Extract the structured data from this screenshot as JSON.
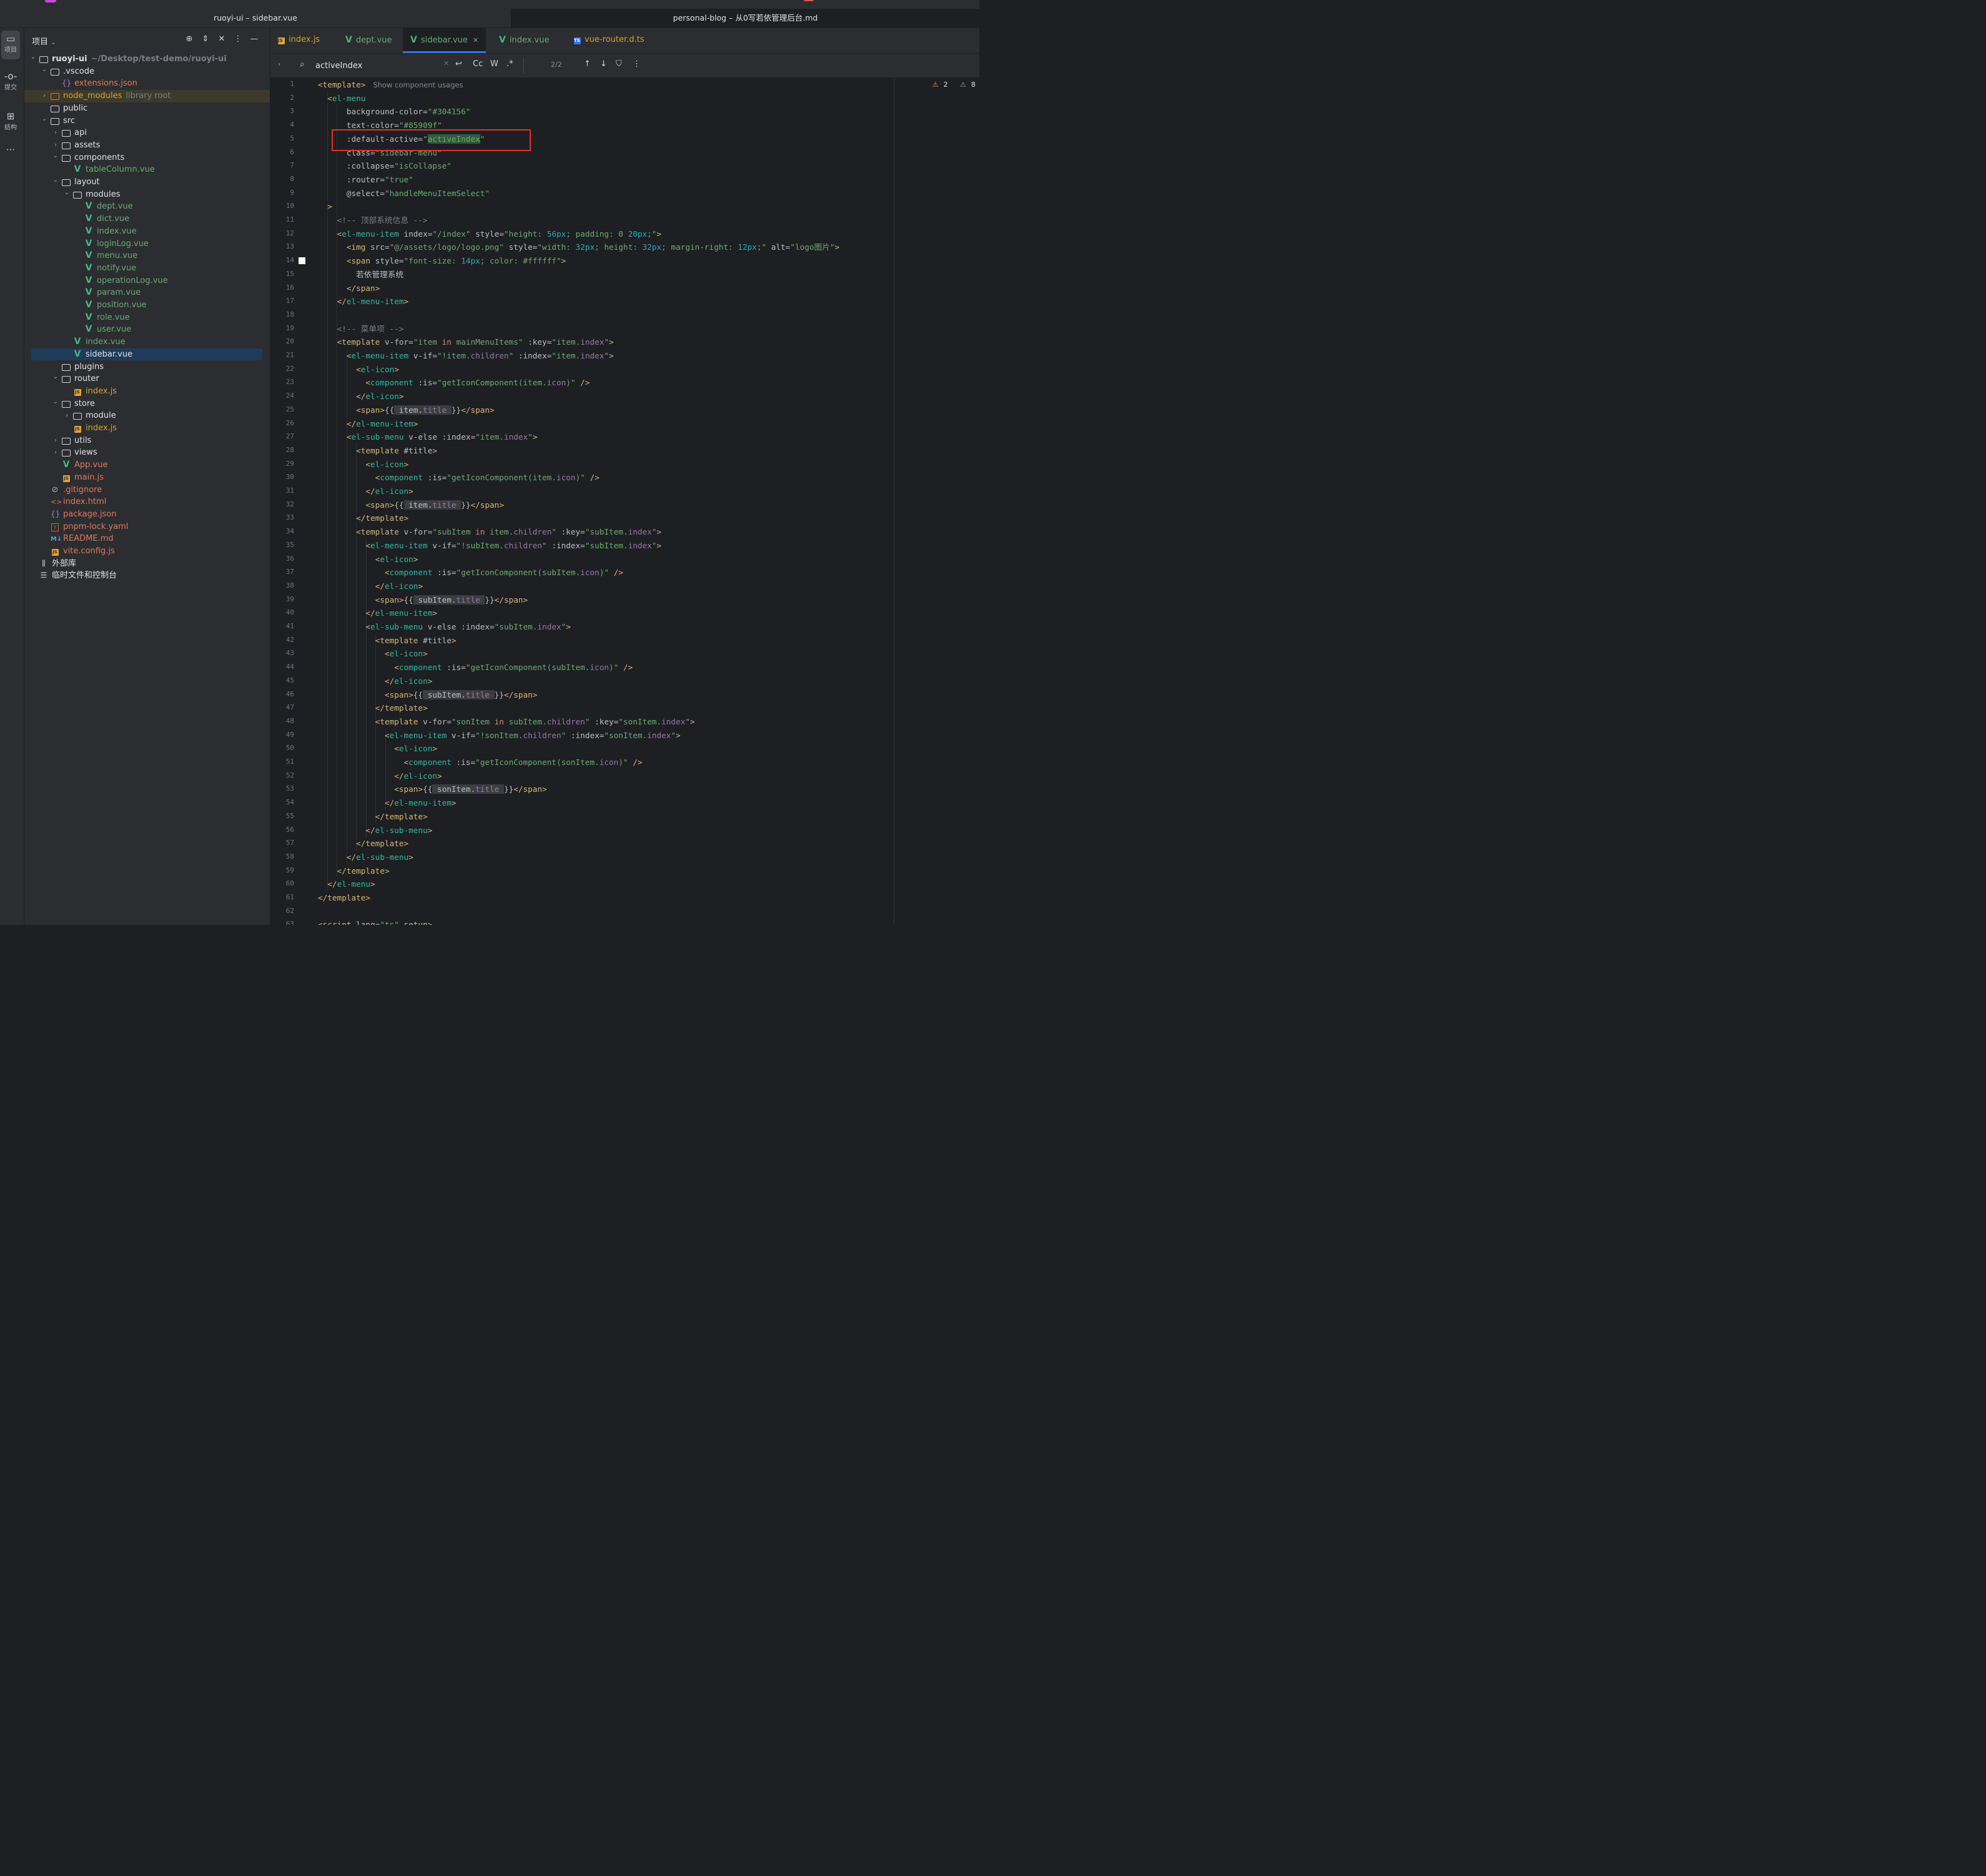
{
  "windows": {
    "left_title": "ruoyi-ui – sidebar.vue",
    "right_title": "personal-blog – 从0写若依管理后台.md"
  },
  "activity_bar": [
    {
      "icon": "folder-icon",
      "label": "项目"
    },
    {
      "icon": "commit-icon",
      "label": "提交"
    },
    {
      "icon": "structure-icon",
      "label": "结构"
    },
    {
      "icon": "more-icon",
      "label": ""
    }
  ],
  "project_panel": {
    "title": "项目",
    "tools": [
      "locate-icon",
      "expand-icon",
      "collapse-icon",
      "more-icon",
      "minimize-icon"
    ]
  },
  "tree": [
    {
      "depth": 0,
      "chev": "down",
      "icon": "folder",
      "name": "ruoyi-ui",
      "hint": "~/Desktop/test-demo/ruoyi-ui",
      "color": "normal",
      "bold": true
    },
    {
      "depth": 1,
      "chev": "down",
      "icon": "folder",
      "name": ".vscode",
      "color": "normal"
    },
    {
      "depth": 2,
      "chev": "",
      "icon": "json",
      "name": "extensions.json",
      "color": "orange"
    },
    {
      "depth": 1,
      "chev": "right",
      "icon": "folder-orange",
      "name": "node_modules",
      "hint": "library root",
      "color": "yellow",
      "row": "hl-orange"
    },
    {
      "depth": 1,
      "chev": "",
      "icon": "folder",
      "name": "public",
      "color": "normal"
    },
    {
      "depth": 1,
      "chev": "down",
      "icon": "folder",
      "name": "src",
      "color": "normal"
    },
    {
      "depth": 2,
      "chev": "right",
      "icon": "folder",
      "name": "api",
      "color": "normal"
    },
    {
      "depth": 2,
      "chev": "right",
      "icon": "folder",
      "name": "assets",
      "color": "normal"
    },
    {
      "depth": 2,
      "chev": "down",
      "icon": "folder",
      "name": "components",
      "color": "normal"
    },
    {
      "depth": 3,
      "chev": "",
      "icon": "vue",
      "name": "tableColumn.vue",
      "color": "green"
    },
    {
      "depth": 2,
      "chev": "down",
      "icon": "folder",
      "name": "layout",
      "color": "normal"
    },
    {
      "depth": 3,
      "chev": "down",
      "icon": "folder",
      "name": "modules",
      "color": "normal"
    },
    {
      "depth": 4,
      "chev": "",
      "icon": "vue",
      "name": "dept.vue",
      "color": "green"
    },
    {
      "depth": 4,
      "chev": "",
      "icon": "vue",
      "name": "dict.vue",
      "color": "green"
    },
    {
      "depth": 4,
      "chev": "",
      "icon": "vue",
      "name": "index.vue",
      "color": "green"
    },
    {
      "depth": 4,
      "chev": "",
      "icon": "vue",
      "name": "loginLog.vue",
      "color": "green"
    },
    {
      "depth": 4,
      "chev": "",
      "icon": "vue",
      "name": "menu.vue",
      "color": "green"
    },
    {
      "depth": 4,
      "chev": "",
      "icon": "vue",
      "name": "notify.vue",
      "color": "green"
    },
    {
      "depth": 4,
      "chev": "",
      "icon": "vue",
      "name": "operationLog.vue",
      "color": "green"
    },
    {
      "depth": 4,
      "chev": "",
      "icon": "vue",
      "name": "param.vue",
      "color": "green"
    },
    {
      "depth": 4,
      "chev": "",
      "icon": "vue",
      "name": "position.vue",
      "color": "green"
    },
    {
      "depth": 4,
      "chev": "",
      "icon": "vue",
      "name": "role.vue",
      "color": "green"
    },
    {
      "depth": 4,
      "chev": "",
      "icon": "vue",
      "name": "user.vue",
      "color": "green"
    },
    {
      "depth": 3,
      "chev": "",
      "icon": "vue",
      "name": "index.vue",
      "color": "green"
    },
    {
      "depth": 3,
      "chev": "",
      "icon": "vue",
      "name": "sidebar.vue",
      "color": "green",
      "row": "selected"
    },
    {
      "depth": 2,
      "chev": "",
      "icon": "folder",
      "name": "plugins",
      "color": "normal"
    },
    {
      "depth": 2,
      "chev": "down",
      "icon": "folder",
      "name": "router",
      "color": "normal"
    },
    {
      "depth": 3,
      "chev": "",
      "icon": "js",
      "name": "index.js",
      "color": "yellow"
    },
    {
      "depth": 2,
      "chev": "down",
      "icon": "folder",
      "name": "store",
      "color": "normal"
    },
    {
      "depth": 3,
      "chev": "right",
      "icon": "folder",
      "name": "module",
      "color": "normal"
    },
    {
      "depth": 3,
      "chev": "",
      "icon": "js",
      "name": "index.js",
      "color": "yellow"
    },
    {
      "depth": 2,
      "chev": "right",
      "icon": "folder",
      "name": "utils",
      "color": "normal"
    },
    {
      "depth": 2,
      "chev": "right",
      "icon": "folder",
      "name": "views",
      "color": "normal"
    },
    {
      "depth": 2,
      "chev": "",
      "icon": "vue",
      "name": "App.vue",
      "color": "orange"
    },
    {
      "depth": 2,
      "chev": "",
      "icon": "js",
      "name": "main.js",
      "color": "orange"
    },
    {
      "depth": 1,
      "chev": "",
      "icon": "git",
      "name": ".gitignore",
      "color": "orange"
    },
    {
      "depth": 1,
      "chev": "",
      "icon": "html",
      "name": "index.html",
      "color": "orange"
    },
    {
      "depth": 1,
      "chev": "",
      "icon": "json",
      "name": "package.json",
      "color": "orange"
    },
    {
      "depth": 1,
      "chev": "",
      "icon": "yaml",
      "name": "pnpm-lock.yaml",
      "color": "orange"
    },
    {
      "depth": 1,
      "chev": "",
      "icon": "md",
      "name": "README.md",
      "color": "orange"
    },
    {
      "depth": 1,
      "chev": "",
      "icon": "js",
      "name": "vite.config.js",
      "color": "orange"
    },
    {
      "depth": 0,
      "chev": "",
      "icon": "lib",
      "name": "外部库",
      "color": "normal"
    },
    {
      "depth": 0,
      "chev": "",
      "icon": "scratch",
      "name": "临时文件和控制台",
      "color": "normal"
    }
  ],
  "tabs": [
    {
      "icon": "js",
      "label": "index.js",
      "color": "#cfa33d",
      "active": false
    },
    {
      "icon": "vue",
      "label": "dept.vue",
      "color": "#6aab73",
      "active": false
    },
    {
      "icon": "vue",
      "label": "sidebar.vue",
      "color": "#6aab73",
      "active": true
    },
    {
      "icon": "vue",
      "label": "index.vue",
      "color": "#6aab73",
      "active": false
    },
    {
      "icon": "ts",
      "label": "vue-router.d.ts",
      "color": "#cfa33d",
      "active": false
    }
  ],
  "search": {
    "value": "activeIndex",
    "case_label": "Cc",
    "word_label": "W",
    "regex_label": ".*",
    "count": "2/2"
  },
  "inspections": {
    "warnings": "2",
    "weak_warnings": "8"
  },
  "code": [
    "<template> Show component usages",
    "  <el-menu",
    "      background-color=\"#304156\"",
    "      text-color=\"#85909f\"",
    "      :default-active=\"activeIndex\"",
    "      class=\"sidebar-menu\"",
    "      :collapse=\"isCollapse\"",
    "      :router=\"true\"",
    "      @select=\"handleMenuItemSelect\"",
    "  >",
    "    <!-- 顶部系统信息 -->",
    "    <el-menu-item index=\"/index\" style=\"height: 56px; padding: 0 20px;\">",
    "      <img src=\"@/assets/logo/logo.png\" style=\"width: 32px; height: 32px; margin-right: 12px;\" alt=\"logo图片\">",
    "      <span style=\"font-size: 14px; color: #ffffff\">",
    "        若依管理系统",
    "      </span>",
    "    </el-menu-item>",
    "",
    "    <!-- 菜单项 -->",
    "    <template v-for=\"item in mainMenuItems\" :key=\"item.index\">",
    "      <el-menu-item v-if=\"!item.children\" :index=\"item.index\">",
    "        <el-icon>",
    "          <component :is=\"getIconComponent(item.icon)\" />",
    "        </el-icon>",
    "        <span>{{ item.title }}</span>",
    "      </el-menu-item>",
    "      <el-sub-menu v-else :index=\"item.index\">",
    "        <template #title>",
    "          <el-icon>",
    "            <component :is=\"getIconComponent(item.icon)\" />",
    "          </el-icon>",
    "          <span>{{ item.title }}</span>",
    "        </template>",
    "        <template v-for=\"subItem in item.children\" :key=\"subItem.index\">",
    "          <el-menu-item v-if=\"!subItem.children\" :index=\"subItem.index\">",
    "            <el-icon>",
    "              <component :is=\"getIconComponent(subItem.icon)\" />",
    "            </el-icon>",
    "            <span>{{ subItem.title }}</span>",
    "          </el-menu-item>",
    "          <el-sub-menu v-else :index=\"subItem.index\">",
    "            <template #title>",
    "              <el-icon>",
    "                <component :is=\"getIconComponent(subItem.icon)\" />",
    "              </el-icon>",
    "              <span>{{ subItem.title }}</span>",
    "            </template>",
    "            <template v-for=\"sonItem in subItem.children\" :key=\"sonItem.index\">",
    "              <el-menu-item v-if=\"!sonItem.children\" :index=\"sonItem.index\">",
    "                <el-icon>",
    "                  <component :is=\"getIconComponent(sonItem.icon)\" />",
    "                </el-icon>",
    "                <span>{{ sonItem.title }}</span>",
    "              </el-menu-item>",
    "            </template>",
    "          </el-sub-menu>",
    "        </template>",
    "      </el-sub-menu>",
    "    </template>",
    "  </el-menu>",
    "</template>",
    "",
    "<script lang=\"ts\" setup>"
  ],
  "highlight_line": 5,
  "selected_line_marker": 14
}
